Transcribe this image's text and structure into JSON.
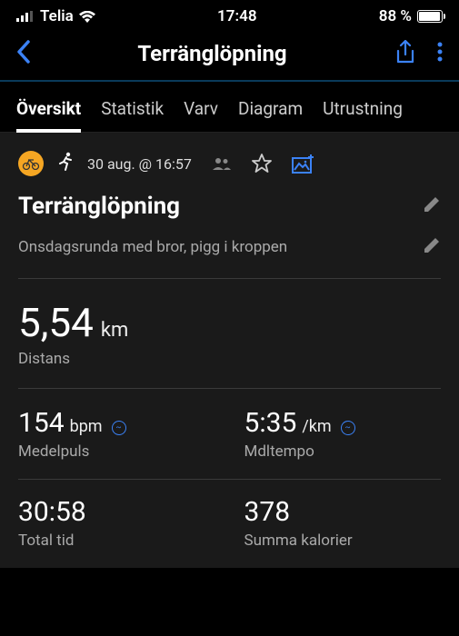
{
  "status": {
    "signal_icon": "●●●",
    "carrier": "Telia",
    "time": "17:48",
    "battery_pct": "88 %"
  },
  "nav": {
    "title": "Terränglöpning"
  },
  "tabs": [
    {
      "label": "Översikt",
      "active": true
    },
    {
      "label": "Statistik",
      "active": false
    },
    {
      "label": "Varv",
      "active": false
    },
    {
      "label": "Diagram",
      "active": false
    },
    {
      "label": "Utrustning",
      "active": false
    }
  ],
  "activity": {
    "date_time": "30 aug. @ 16:57",
    "title": "Terränglöpning",
    "description": "Onsdagsrunda med bror, pigg i kroppen"
  },
  "stats": {
    "distance": {
      "value": "5,54",
      "unit": "km",
      "label": "Distans"
    },
    "hr": {
      "value": "154",
      "unit": "bpm",
      "label": "Medelpuls"
    },
    "pace": {
      "value": "5:35",
      "unit": "/km",
      "label": "Mdltempo"
    },
    "time": {
      "value": "30:58",
      "unit": "",
      "label": "Total tid"
    },
    "calories": {
      "value": "378",
      "unit": "",
      "label": "Summa kalorier"
    }
  }
}
